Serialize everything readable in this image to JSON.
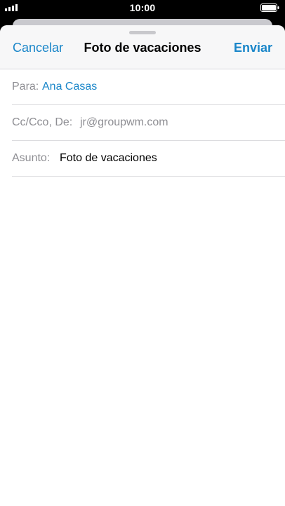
{
  "status_bar": {
    "time": "10:00",
    "signal_icon": "signal-bars-icon",
    "battery_icon": "battery-full-icon"
  },
  "nav": {
    "cancel_label": "Cancelar",
    "title": "Foto de vacaciones",
    "send_label": "Enviar"
  },
  "fields": {
    "to_label": "Para:",
    "to_value": "Ana Casas",
    "cc_label": "Cc/Cco, De:",
    "cc_value": "jr@groupwm.com",
    "subject_label": "Asunto:",
    "subject_value": "Foto de vacaciones"
  },
  "colors": {
    "accent": "#1a86c9",
    "label_gray": "#8e8e93",
    "background": "#ffffff"
  }
}
